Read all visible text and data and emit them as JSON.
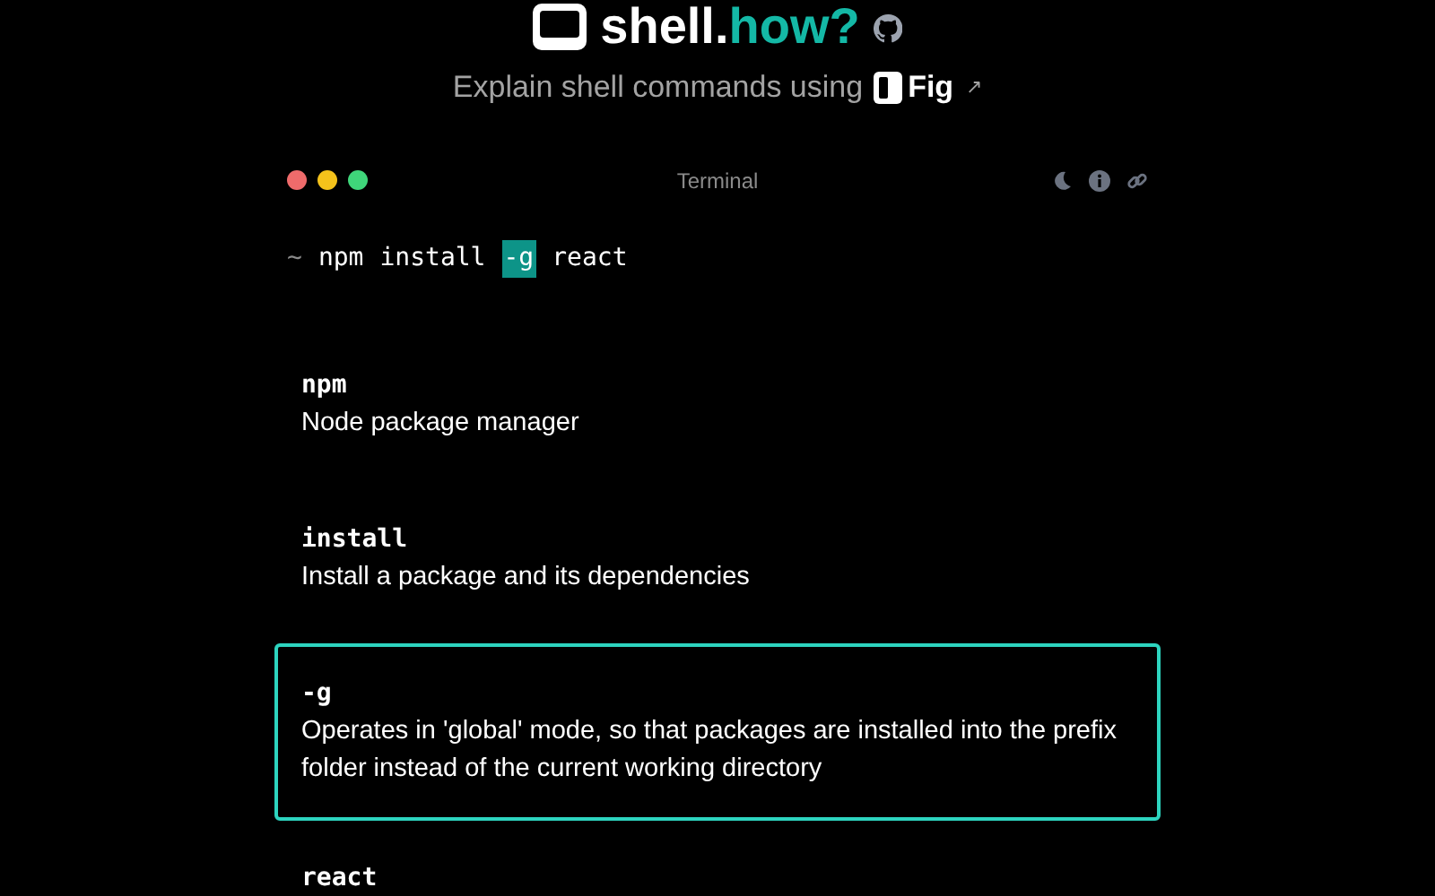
{
  "header": {
    "logo_text": "shell.",
    "logo_accent": "how?",
    "tagline": "Explain shell commands using",
    "brand": "Fig",
    "brand_arrow": "↗"
  },
  "terminal": {
    "title": "Terminal",
    "prompt": "~",
    "tokens": [
      {
        "text": "npm",
        "selected": false
      },
      {
        "text": "install",
        "selected": false
      },
      {
        "text": "-g",
        "selected": true
      },
      {
        "text": "react",
        "selected": false
      }
    ]
  },
  "explanations": [
    {
      "token": "npm",
      "description": "Node package manager",
      "selected": false
    },
    {
      "token": "install",
      "description": "Install a package and its dependencies",
      "selected": false
    },
    {
      "token": "-g",
      "description": "Operates in 'global' mode, so that packages are installed into the prefix folder instead of the current working directory",
      "selected": true
    },
    {
      "token": "react",
      "selected": false
    }
  ]
}
